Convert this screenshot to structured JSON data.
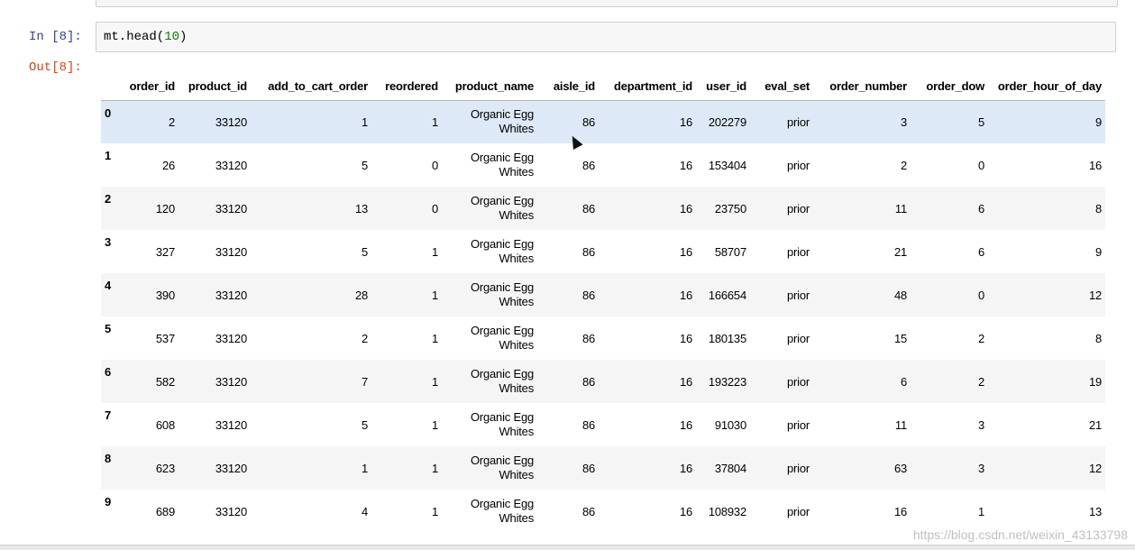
{
  "in_prompt": "In [8]:",
  "out_prompt": "Out[8]:",
  "code": {
    "prefix": "mt.head(",
    "arg": "10",
    "suffix": ")"
  },
  "columns": [
    "",
    "order_id",
    "product_id",
    "add_to_cart_order",
    "reordered",
    "product_name",
    "aisle_id",
    "department_id",
    "user_id",
    "eval_set",
    "order_number",
    "order_dow",
    "order_hour_of_day"
  ],
  "rows": [
    {
      "index": "0",
      "order_id": "2",
      "product_id": "33120",
      "add_to_cart_order": "1",
      "reordered": "1",
      "product_name_1": "Organic Egg",
      "product_name_2": "Whites",
      "aisle_id": "86",
      "department_id": "16",
      "user_id": "202279",
      "eval_set": "prior",
      "order_number": "3",
      "order_dow": "5",
      "order_hour_of_day": "9"
    },
    {
      "index": "1",
      "order_id": "26",
      "product_id": "33120",
      "add_to_cart_order": "5",
      "reordered": "0",
      "product_name_1": "Organic Egg",
      "product_name_2": "Whites",
      "aisle_id": "86",
      "department_id": "16",
      "user_id": "153404",
      "eval_set": "prior",
      "order_number": "2",
      "order_dow": "0",
      "order_hour_of_day": "16"
    },
    {
      "index": "2",
      "order_id": "120",
      "product_id": "33120",
      "add_to_cart_order": "13",
      "reordered": "0",
      "product_name_1": "Organic Egg",
      "product_name_2": "Whites",
      "aisle_id": "86",
      "department_id": "16",
      "user_id": "23750",
      "eval_set": "prior",
      "order_number": "11",
      "order_dow": "6",
      "order_hour_of_day": "8"
    },
    {
      "index": "3",
      "order_id": "327",
      "product_id": "33120",
      "add_to_cart_order": "5",
      "reordered": "1",
      "product_name_1": "Organic Egg",
      "product_name_2": "Whites",
      "aisle_id": "86",
      "department_id": "16",
      "user_id": "58707",
      "eval_set": "prior",
      "order_number": "21",
      "order_dow": "6",
      "order_hour_of_day": "9"
    },
    {
      "index": "4",
      "order_id": "390",
      "product_id": "33120",
      "add_to_cart_order": "28",
      "reordered": "1",
      "product_name_1": "Organic Egg",
      "product_name_2": "Whites",
      "aisle_id": "86",
      "department_id": "16",
      "user_id": "166654",
      "eval_set": "prior",
      "order_number": "48",
      "order_dow": "0",
      "order_hour_of_day": "12"
    },
    {
      "index": "5",
      "order_id": "537",
      "product_id": "33120",
      "add_to_cart_order": "2",
      "reordered": "1",
      "product_name_1": "Organic Egg",
      "product_name_2": "Whites",
      "aisle_id": "86",
      "department_id": "16",
      "user_id": "180135",
      "eval_set": "prior",
      "order_number": "15",
      "order_dow": "2",
      "order_hour_of_day": "8"
    },
    {
      "index": "6",
      "order_id": "582",
      "product_id": "33120",
      "add_to_cart_order": "7",
      "reordered": "1",
      "product_name_1": "Organic Egg",
      "product_name_2": "Whites",
      "aisle_id": "86",
      "department_id": "16",
      "user_id": "193223",
      "eval_set": "prior",
      "order_number": "6",
      "order_dow": "2",
      "order_hour_of_day": "19"
    },
    {
      "index": "7",
      "order_id": "608",
      "product_id": "33120",
      "add_to_cart_order": "5",
      "reordered": "1",
      "product_name_1": "Organic Egg",
      "product_name_2": "Whites",
      "aisle_id": "86",
      "department_id": "16",
      "user_id": "91030",
      "eval_set": "prior",
      "order_number": "11",
      "order_dow": "3",
      "order_hour_of_day": "21"
    },
    {
      "index": "8",
      "order_id": "623",
      "product_id": "33120",
      "add_to_cart_order": "1",
      "reordered": "1",
      "product_name_1": "Organic Egg",
      "product_name_2": "Whites",
      "aisle_id": "86",
      "department_id": "16",
      "user_id": "37804",
      "eval_set": "prior",
      "order_number": "63",
      "order_dow": "3",
      "order_hour_of_day": "12"
    },
    {
      "index": "9",
      "order_id": "689",
      "product_id": "33120",
      "add_to_cart_order": "4",
      "reordered": "1",
      "product_name_1": "Organic Egg",
      "product_name_2": "Whites",
      "aisle_id": "86",
      "department_id": "16",
      "user_id": "108932",
      "eval_set": "prior",
      "order_number": "16",
      "order_dow": "1",
      "order_hour_of_day": "13"
    }
  ],
  "watermark": "https://blog.csdn.net/weixin_43133798"
}
